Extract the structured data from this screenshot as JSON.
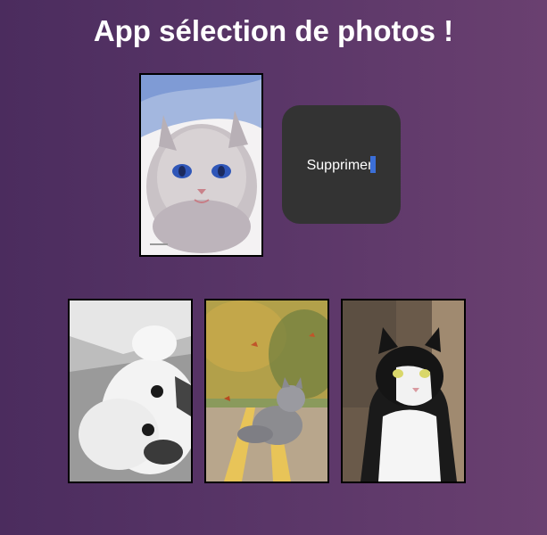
{
  "page": {
    "title": "App sélection de photos !"
  },
  "selected_photo": {
    "description_icon": "watercolor-cat-photo"
  },
  "actions": {
    "delete_label": "Supprimer"
  },
  "gallery": [
    {
      "icon": "bw-cat-photo"
    },
    {
      "icon": "autumn-cat-photo"
    },
    {
      "icon": "tuxedo-cat-photo"
    }
  ],
  "colors": {
    "background_start": "#4b2c5e",
    "background_end": "#6a4070",
    "button_bg": "#333333",
    "text": "#ffffff"
  }
}
